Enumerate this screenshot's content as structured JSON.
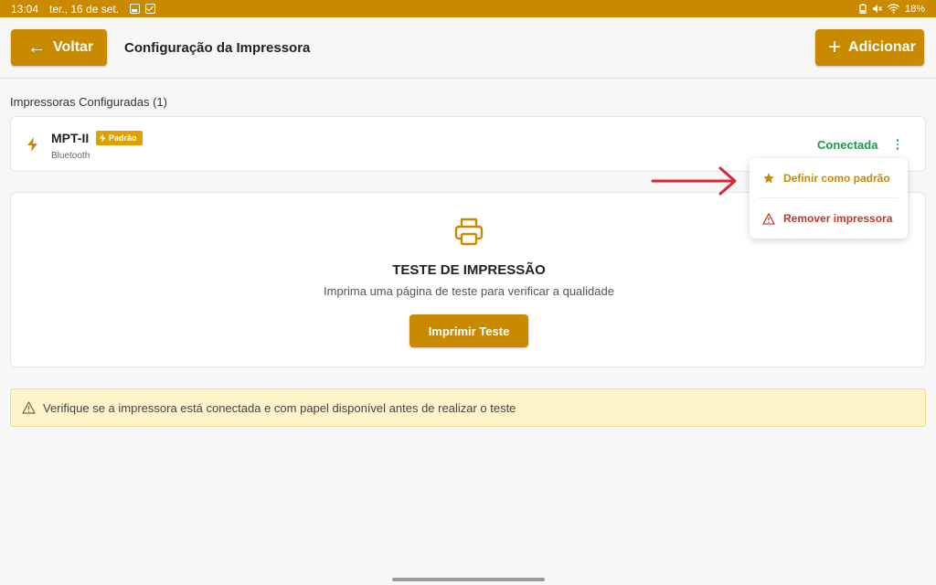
{
  "status_bar": {
    "time": "13:04",
    "date": "ter., 16 de set.",
    "battery": "18%",
    "icons": [
      "image-icon",
      "check-icon",
      "battery-icon",
      "mute-icon",
      "wifi-icon"
    ]
  },
  "header": {
    "back_label": "Voltar",
    "title": "Configuração da Impressora",
    "add_label": "Adicionar"
  },
  "printers": {
    "section_label": "Impressoras Configuradas (1)",
    "items": [
      {
        "name": "MPT-II",
        "badge": "Padrão",
        "type": "Bluetooth",
        "status": "Conectada"
      }
    ]
  },
  "menu": {
    "set_default": "Definir como padrão",
    "remove": "Remover impressora"
  },
  "test": {
    "title": "TESTE DE IMPRESSÃO",
    "subtitle": "Imprima uma página de teste para verificar a qualidade",
    "button": "Imprimir Teste"
  },
  "warning": {
    "text": "Verifique se a impressora está conectada e com papel disponível antes de realizar o teste"
  },
  "colors": {
    "primary": "#c98a00",
    "success": "#1a9a45",
    "danger": "#c0392b",
    "warning_bg": "#fdf4c9",
    "annotation": "#d9263a"
  }
}
